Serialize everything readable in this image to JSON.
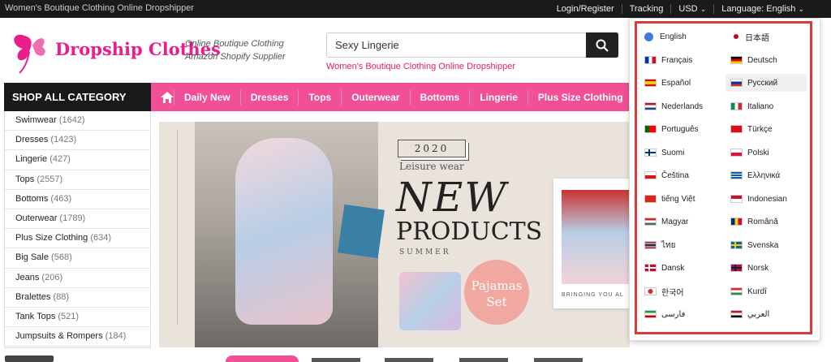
{
  "topbar": {
    "site_title": "Women's Boutique Clothing Online Dropshipper",
    "login": "Login/Register",
    "tracking": "Tracking",
    "currency": "USD",
    "language": "Language: English"
  },
  "brand": {
    "logo_text": "Dropship Clothes",
    "tagline_1": "Online Boutique Clothing",
    "tagline_2": "Amazon Shopify Supplier"
  },
  "search": {
    "value": "Sexy Lingerie",
    "subtitle": "Women's Boutique Clothing Online Dropshipper"
  },
  "sidebar": {
    "heading": "SHOP ALL CATEGORY",
    "items": [
      {
        "label": "Swimwear",
        "count": "(1642)"
      },
      {
        "label": "Dresses",
        "count": "(1423)"
      },
      {
        "label": "Lingerie",
        "count": "(427)"
      },
      {
        "label": "Tops",
        "count": "(2557)"
      },
      {
        "label": "Bottoms",
        "count": "(463)"
      },
      {
        "label": "Outerwear",
        "count": "(1789)"
      },
      {
        "label": "Plus Size Clothing",
        "count": "(634)"
      },
      {
        "label": "Big Sale",
        "count": "(568)"
      },
      {
        "label": "Jeans",
        "count": "(206)"
      },
      {
        "label": "Bralettes",
        "count": "(88)"
      },
      {
        "label": "Tank Tops",
        "count": "(521)"
      },
      {
        "label": "Jumpsuits & Rompers",
        "count": "(184)"
      }
    ]
  },
  "nav": {
    "items": [
      "Daily New",
      "Dresses",
      "Tops",
      "Outerwear",
      "Bottoms",
      "Lingerie",
      "Plus Size Clothing"
    ]
  },
  "banner": {
    "year": "2020",
    "subtitle": "Leisure wear",
    "headline_1": "NEW",
    "headline_2": "PRODUCTS",
    "season": "SUMMER",
    "badge_1": "Pajamas",
    "badge_2": "Set",
    "caption": "BRINGING YOU AL"
  },
  "languages": [
    {
      "label": "English",
      "flag": "globe"
    },
    {
      "label": "日本語",
      "flag": "jp"
    },
    {
      "label": "Français",
      "flag": "fr"
    },
    {
      "label": "Deutsch",
      "flag": "de"
    },
    {
      "label": "Español",
      "flag": "es"
    },
    {
      "label": "Русский",
      "flag": "ru"
    },
    {
      "label": "Nederlands",
      "flag": "nl"
    },
    {
      "label": "Italiano",
      "flag": "it"
    },
    {
      "label": "Português",
      "flag": "pt"
    },
    {
      "label": "Türkçe",
      "flag": "tr"
    },
    {
      "label": "Suomi",
      "flag": "fi"
    },
    {
      "label": "Polski",
      "flag": "pl"
    },
    {
      "label": "Čeština",
      "flag": "cz"
    },
    {
      "label": "Ελληνικά",
      "flag": "gr"
    },
    {
      "label": "tiếng Việt",
      "flag": "vn"
    },
    {
      "label": "Indonesian",
      "flag": "id"
    },
    {
      "label": "Magyar",
      "flag": "hu"
    },
    {
      "label": "Română",
      "flag": "ro"
    },
    {
      "label": "ไทย",
      "flag": "th"
    },
    {
      "label": "Svenska",
      "flag": "se"
    },
    {
      "label": "Dansk",
      "flag": "dk"
    },
    {
      "label": "Norsk",
      "flag": "no"
    },
    {
      "label": "한국어",
      "flag": "kr"
    },
    {
      "label": "Kurdî",
      "flag": "kurd"
    },
    {
      "label": "فارسی",
      "flag": "ir"
    },
    {
      "label": "العربي",
      "flag": "iq"
    }
  ],
  "colors": {
    "accent": "#f14f96",
    "highlight": "#d93b3b",
    "dark": "#1a1a1a"
  }
}
